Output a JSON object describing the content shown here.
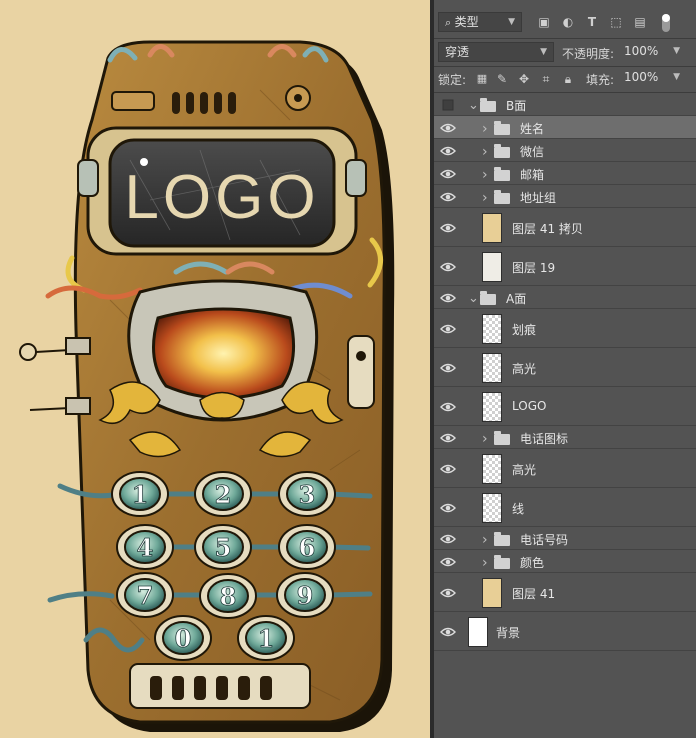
{
  "canvas": {
    "background": "#e9d3a3",
    "logo_text": "LOGO",
    "keys": [
      "1",
      "2",
      "3",
      "4",
      "5",
      "6",
      "7",
      "8",
      "9",
      "0",
      "1"
    ]
  },
  "panel": {
    "filter_kind": "类型",
    "blend_mode": "穿透",
    "opacity_label": "不透明度:",
    "opacity_value": "100%",
    "lock_label": "锁定:",
    "fill_label": "填充:",
    "fill_value": "100%"
  },
  "layers": [
    {
      "name": "B面",
      "type": "group",
      "expanded": true,
      "indent": 0,
      "visible": false,
      "selected": false
    },
    {
      "name": "姓名",
      "type": "group",
      "expanded": false,
      "indent": 1,
      "visible": true,
      "selected": true
    },
    {
      "name": "微信",
      "type": "group",
      "expanded": false,
      "indent": 1,
      "visible": true,
      "selected": false
    },
    {
      "name": "邮箱",
      "type": "group",
      "expanded": false,
      "indent": 1,
      "visible": true,
      "selected": false
    },
    {
      "name": "地址组",
      "type": "group",
      "expanded": false,
      "indent": 1,
      "visible": true,
      "selected": false
    },
    {
      "name": "图层 41 拷贝",
      "type": "layer",
      "thumb": "#e8cf96",
      "indent": 1,
      "visible": true,
      "selected": false
    },
    {
      "name": "图层 19",
      "type": "layer",
      "thumb": "#efede6",
      "indent": 1,
      "visible": true,
      "selected": false
    },
    {
      "name": "A面",
      "type": "group",
      "expanded": true,
      "indent": 0,
      "visible": true,
      "selected": false
    },
    {
      "name": "划痕",
      "type": "layer",
      "thumb": "checker",
      "indent": 1,
      "visible": true,
      "selected": false
    },
    {
      "name": "高光",
      "type": "layer",
      "thumb": "checker",
      "indent": 1,
      "visible": true,
      "selected": false
    },
    {
      "name": "LOGO",
      "type": "layer",
      "thumb": "checker",
      "indent": 1,
      "visible": true,
      "selected": false
    },
    {
      "name": "电话图标",
      "type": "group",
      "expanded": false,
      "indent": 1,
      "visible": true,
      "selected": false
    },
    {
      "name": "高光",
      "type": "layer",
      "thumb": "checker",
      "indent": 1,
      "visible": true,
      "selected": false
    },
    {
      "name": "线",
      "type": "layer",
      "thumb": "checker",
      "indent": 1,
      "visible": true,
      "selected": false
    },
    {
      "name": "电话号码",
      "type": "group",
      "expanded": false,
      "indent": 1,
      "visible": true,
      "selected": false
    },
    {
      "name": "颜色",
      "type": "group",
      "expanded": false,
      "indent": 1,
      "visible": true,
      "selected": false
    },
    {
      "name": "图层 41",
      "type": "layer",
      "thumb": "#e8cf96",
      "indent": 1,
      "visible": true,
      "selected": false
    },
    {
      "name": "背景",
      "type": "layer",
      "thumb": "#ffffff",
      "indent": 0,
      "visible": true,
      "selected": false
    }
  ]
}
